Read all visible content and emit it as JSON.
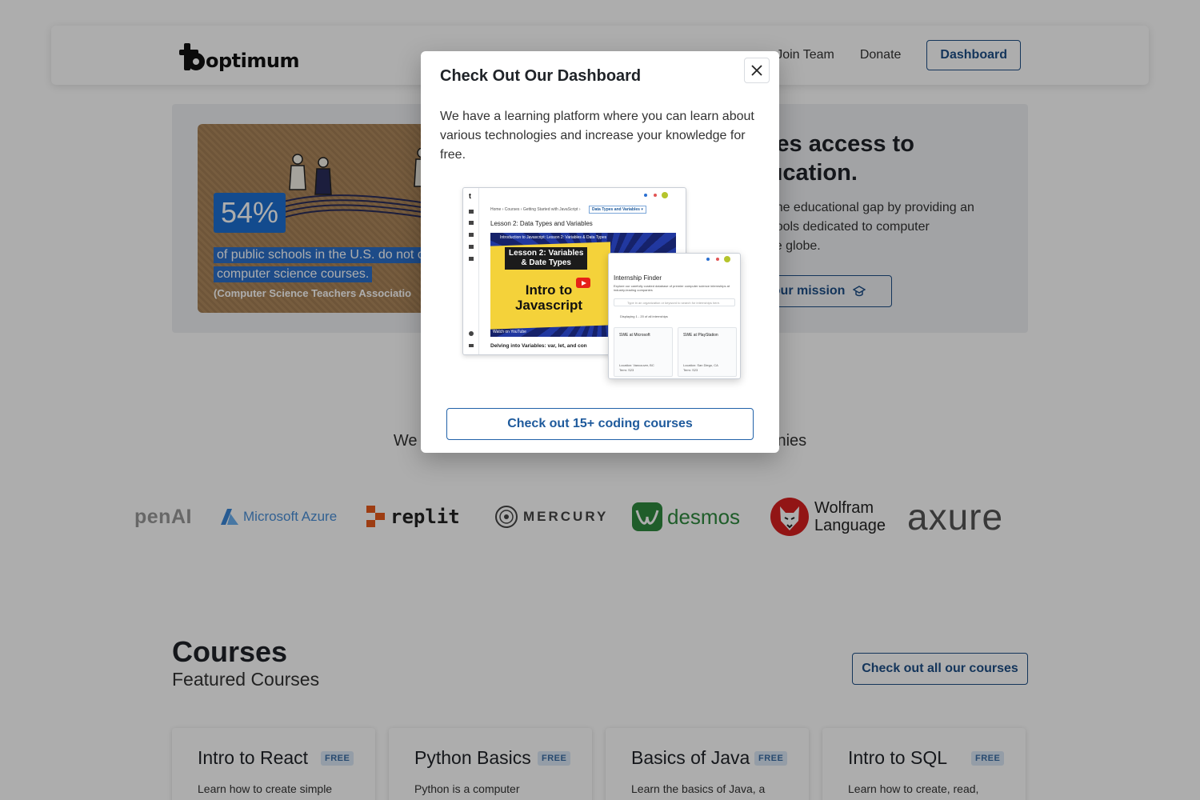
{
  "header": {
    "logo_text": "optimum",
    "nav": {
      "partial": "…",
      "join": "Join Team",
      "donate": "Donate",
      "dashboard": "Dashboard"
    }
  },
  "hero": {
    "stat_value": "54%",
    "stat_line1": "of public schools in the U.S. do not o",
    "stat_line2": "computer science courses.",
    "stat_source": "(Computer Science Teachers Associatio",
    "title_line1": "rves access to",
    "title_line2": "ducation.",
    "text_line1": "ng the educational gap by providing an",
    "text_line2": "nd tools dedicated to computer",
    "text_line3": "s the globe.",
    "mission_button": "t our mission"
  },
  "partners": {
    "heading_left": "We",
    "heading_right": "nies",
    "logos": {
      "openai": "penAI",
      "azure": "Microsoft Azure",
      "replit": "replit",
      "mercury": "MERCURY",
      "desmos": "desmos",
      "wolfram_1": "Wolfram",
      "wolfram_2": "Language",
      "axure": "axure"
    }
  },
  "courses": {
    "title": "Courses",
    "subtitle": "Featured Courses",
    "all_button": "Check out all our courses",
    "cards": [
      {
        "title": "Intro to React",
        "badge": "FREE",
        "desc": "Learn how to create simple"
      },
      {
        "title": "Python Basics",
        "badge": "FREE",
        "desc": "Python is a computer"
      },
      {
        "title": "Basics of Java",
        "badge": "FREE",
        "desc": "Learn the basics of Java, a"
      },
      {
        "title": "Intro to SQL",
        "badge": "FREE",
        "desc": "Learn how to create, read,"
      }
    ]
  },
  "modal": {
    "title": "Check Out Our Dashboard",
    "body": "We have a learning platform where you can learn about various technologies and increase your knowledge for free.",
    "cta": "Check out 15+ coding courses",
    "preview": {
      "breadcrumb": "Home  ›  Courses  ›  Getting Started with JavaScript  ›",
      "crumb_active": "Data Types and Variables  ▾",
      "lesson_title": "Lesson 2: Data Types and Variables",
      "video_title": "Introduction to Javascript: Lesson 2: Variables & Data Types",
      "video_tag_1": "Lesson 2: Variables",
      "video_tag_2": "& Date Types",
      "video_big_1": "Intro to",
      "video_big_2": "Javascript",
      "watch_on": "Watch on  YouTube",
      "footer": "Delving into Variables: var, let, and con",
      "popup_title": "Internship Finder",
      "popup_desc": "Explore our carefully curated database of premier computer science internships at industry-leading companies",
      "popup_search": "Type in an organization or keyword to search for internships here.",
      "popup_count": "Displaying 1 - 20 of all internships",
      "job1_title": "SWE at Microsoft",
      "job1_loc": "Location: Vancouver, BC",
      "job1_term": "Term: S23",
      "job2_title": "SWE at PlayStation",
      "job2_loc": "Location: San Diego, CA",
      "job2_term": "Term: S23"
    }
  },
  "colors": {
    "accent": "#1e4f86",
    "badge_bg": "#dbe8f6",
    "overlay": "rgba(0,0,0,0.32)",
    "stat_blue": "#1c6fd1"
  }
}
